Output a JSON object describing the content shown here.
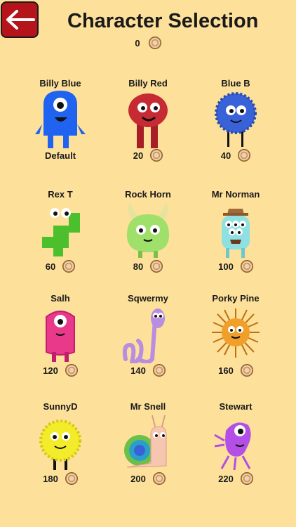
{
  "header": {
    "back_icon": "arrow-left-icon",
    "title": "Character Selection",
    "coins": "0",
    "coin_icon": "coin-icon"
  },
  "characters": [
    {
      "name": "Billy Blue",
      "price": "Default",
      "color": "#1f63f0"
    },
    {
      "name": "Billy Red",
      "price": "20",
      "color": "#c62a32"
    },
    {
      "name": "Blue B",
      "price": "40",
      "color": "#3a62d8"
    },
    {
      "name": "Rex T",
      "price": "60",
      "color": "#4cc02c"
    },
    {
      "name": "Rock Horn",
      "price": "80",
      "color": "#9ee06a"
    },
    {
      "name": "Mr Norman",
      "price": "100",
      "color": "#8ee0e2"
    },
    {
      "name": "Salh",
      "price": "120",
      "color": "#e8398b"
    },
    {
      "name": "Sqwermy",
      "price": "140",
      "color": "#b98de0"
    },
    {
      "name": "Porky Pine",
      "price": "160",
      "color": "#f0a02a"
    },
    {
      "name": "SunnyD",
      "price": "180",
      "color": "#f3ec2a"
    },
    {
      "name": "Mr Snell",
      "price": "200",
      "color": "#f6c6b0"
    },
    {
      "name": "Stewart",
      "price": "220",
      "color": "#b34ee6"
    }
  ]
}
